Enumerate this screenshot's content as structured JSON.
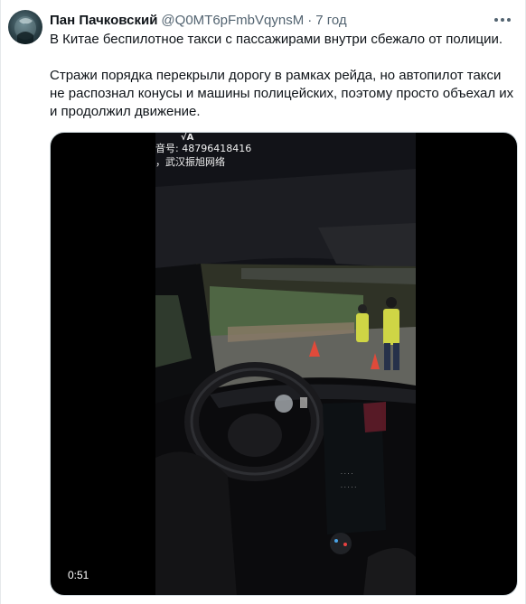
{
  "tweet": {
    "author_name": "Пан Пачковский",
    "handle": "@Q0MT6pFmbVqynsM",
    "separator": "·",
    "time": "7 год",
    "paragraphs": [
      "В Китае беспилотное такси с пассажирами внутри сбежало от полиции.",
      "Стражи порядка перекрыли дорогу в рамках рейда, но автопилот такси не распознал конусы и машины полицейских, поэтому просто объехал их и продолжил движение."
    ]
  },
  "video": {
    "duration": "0:51",
    "watermark_line1": "音号: 48796418416",
    "watermark_line2": "，武汉振旭网络",
    "watermark_logo": "√A"
  },
  "icons": {
    "more": "more-horizontal-icon",
    "avatar": "avatar-image"
  }
}
